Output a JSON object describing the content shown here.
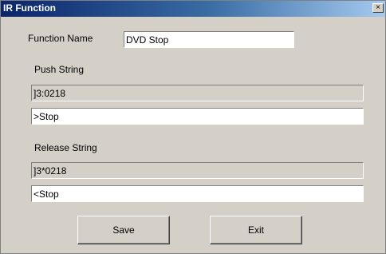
{
  "window": {
    "title": "IR Function",
    "close_glyph": "×"
  },
  "function_name": {
    "label": "Function Name",
    "value": "DVD Stop"
  },
  "push": {
    "label": "Push String",
    "code": "]3:0218",
    "text": ">Stop"
  },
  "release": {
    "label": "Release String",
    "code": "]3*0218",
    "text": "<Stop"
  },
  "buttons": {
    "save": "Save",
    "exit": "Exit"
  }
}
